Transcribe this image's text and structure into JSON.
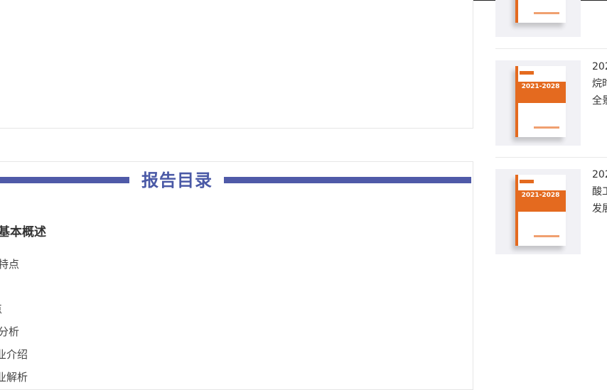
{
  "toc": {
    "title": "报告目录",
    "heading": "业基本概述",
    "items": [
      "及特点",
      "点",
      "链分析",
      "游行业介绍",
      "游行业解析"
    ]
  },
  "sidebar": {
    "reports": [
      {
        "cover_year_text": "",
        "title_lines": [
          "",
          "",
          ""
        ]
      },
      {
        "cover_year_text": "2021-2028",
        "title_lines": [
          "202",
          "烷时",
          "全景"
        ]
      },
      {
        "cover_year_text": "2021-2028",
        "title_lines": [
          "202",
          "酸工",
          "发展"
        ]
      }
    ]
  },
  "colors": {
    "accent": "#4f5aa8",
    "cover_orange": "#e46a1f"
  }
}
